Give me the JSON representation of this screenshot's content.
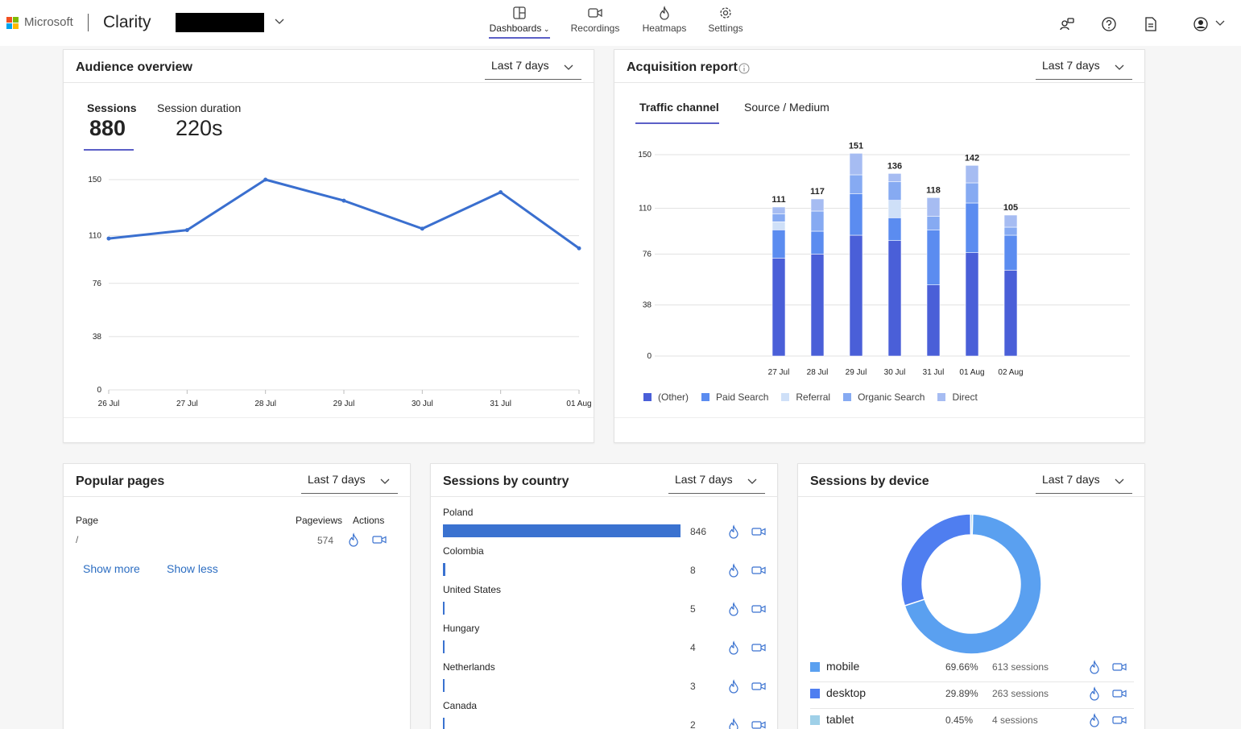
{
  "header": {
    "brand": "Microsoft",
    "app_name": "Clarity",
    "nav": [
      {
        "label": "Dashboards",
        "icon": "dashboard-icon",
        "active": true
      },
      {
        "label": "Recordings",
        "icon": "video-icon"
      },
      {
        "label": "Heatmaps",
        "icon": "flame-icon"
      },
      {
        "label": "Settings",
        "icon": "gear-icon"
      }
    ],
    "right_icons": [
      "people-icon",
      "help-icon",
      "document-icon",
      "account-icon"
    ]
  },
  "audience": {
    "title": "Audience overview",
    "range": "Last 7 days",
    "metrics": [
      {
        "label": "Sessions",
        "value": "880"
      },
      {
        "label": "Session duration",
        "value": "220s"
      }
    ]
  },
  "acquisition": {
    "title": "Acquisition report",
    "range": "Last 7 days",
    "tabs": [
      "Traffic channel",
      "Source / Medium"
    ]
  },
  "popular": {
    "title": "Popular pages",
    "range": "Last 7 days",
    "headers": {
      "page": "Page",
      "pageviews": "Pageviews",
      "actions": "Actions"
    },
    "rows": [
      {
        "page": "/",
        "pageviews": "574"
      }
    ],
    "show_more": "Show more",
    "show_less": "Show less"
  },
  "country": {
    "title": "Sessions by country",
    "range": "Last 7 days",
    "rows": [
      {
        "name": "Poland",
        "count": "846",
        "value": 846
      },
      {
        "name": "Colombia",
        "count": "8",
        "value": 8
      },
      {
        "name": "United States",
        "count": "5",
        "value": 5
      },
      {
        "name": "Hungary",
        "count": "4",
        "value": 4
      },
      {
        "name": "Netherlands",
        "count": "3",
        "value": 3
      },
      {
        "name": "Canada",
        "count": "2",
        "value": 2
      }
    ]
  },
  "device": {
    "title": "Sessions by device",
    "range": "Last 7 days",
    "rows": [
      {
        "name": "mobile",
        "pct": "69.66%",
        "sessions": "613 sessions",
        "color": "#5aa0f0"
      },
      {
        "name": "desktop",
        "pct": "29.89%",
        "sessions": "263 sessions",
        "color": "#4f7ef0"
      },
      {
        "name": "tablet",
        "pct": "0.45%",
        "sessions": "4 sessions",
        "color": "#9fd0e8"
      }
    ]
  },
  "chart_data": [
    {
      "type": "line",
      "x": [
        "26 Jul",
        "27 Jul",
        "28 Jul",
        "29 Jul",
        "30 Jul",
        "31 Jul",
        "01 Aug"
      ],
      "series": [
        {
          "values": [
            108,
            114,
            150,
            135,
            115,
            141,
            101
          ]
        }
      ],
      "yticks": [
        0,
        38,
        76,
        110,
        150
      ],
      "ylim": [
        0,
        150
      ],
      "color": "#3a6fcf"
    },
    {
      "type": "bar",
      "stacked": true,
      "categories": [
        "27 Jul",
        "28 Jul",
        "29 Jul",
        "30 Jul",
        "31 Jul",
        "01 Aug",
        "02 Aug"
      ],
      "totals": [
        111,
        117,
        151,
        136,
        118,
        142,
        105
      ],
      "yticks": [
        0,
        38,
        76,
        110,
        150
      ],
      "ylim": [
        0,
        150
      ],
      "series": [
        {
          "name": "(Other)",
          "color": "#4a5fd8",
          "values": [
            73,
            76,
            90,
            86,
            53,
            77,
            64
          ]
        },
        {
          "name": "Paid Search",
          "color": "#5b8cf0",
          "values": [
            21,
            17,
            31,
            17,
            41,
            37,
            26
          ]
        },
        {
          "name": "Referral",
          "color": "#cfe0f8",
          "values": [
            6,
            0,
            0,
            13,
            0,
            0,
            0
          ]
        },
        {
          "name": "Organic Search",
          "color": "#86aaf2",
          "values": [
            6,
            15,
            14,
            14,
            10,
            15,
            6
          ]
        },
        {
          "name": "Direct",
          "color": "#a6bcf2",
          "values": [
            5,
            9,
            16,
            6,
            14,
            13,
            9
          ]
        }
      ]
    },
    {
      "type": "pie",
      "categories": [
        "mobile",
        "desktop",
        "tablet"
      ],
      "values": [
        69.66,
        29.89,
        0.45
      ],
      "colors": [
        "#5aa0f0",
        "#4f7ef0",
        "#9fd0e8"
      ]
    }
  ]
}
